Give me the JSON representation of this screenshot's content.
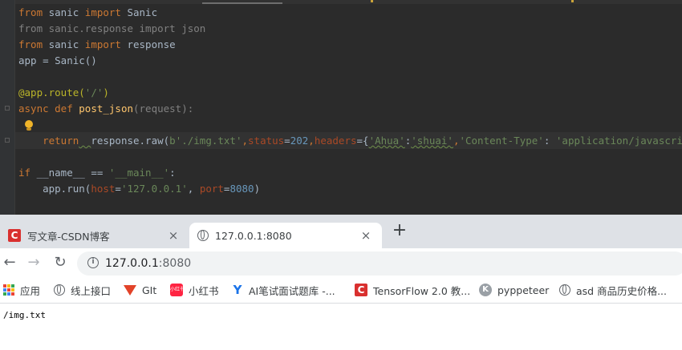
{
  "editor": {
    "lines": [
      {
        "segments": [
          {
            "t": "from",
            "c": "kw"
          },
          {
            "t": " sanic ",
            "c": ""
          },
          {
            "t": "import",
            "c": "kw"
          },
          {
            "t": " Sanic",
            "c": ""
          }
        ]
      },
      {
        "segments": [
          {
            "t": "from sanic.response import json",
            "c": "dim"
          }
        ]
      },
      {
        "segments": [
          {
            "t": "from",
            "c": "kw"
          },
          {
            "t": " sanic ",
            "c": ""
          },
          {
            "t": "import",
            "c": "kw"
          },
          {
            "t": " response",
            "c": ""
          }
        ]
      },
      {
        "segments": [
          {
            "t": "app = Sanic()",
            "c": ""
          }
        ]
      },
      {
        "segments": []
      },
      {
        "segments": [
          {
            "t": "@app.route(",
            "c": "dec"
          },
          {
            "t": "'/'",
            "c": "str"
          },
          {
            "t": ")",
            "c": "dec"
          }
        ]
      },
      {
        "segments": [
          {
            "t": "async def ",
            "c": "kw"
          },
          {
            "t": "post_json",
            "c": "fn"
          },
          {
            "t": "(request):",
            "c": "dim"
          }
        ]
      },
      {
        "segments": []
      },
      {
        "segments": [
          {
            "t": "    ",
            "c": ""
          },
          {
            "t": "return",
            "c": "kw"
          },
          {
            "t": "  ",
            "c": "squig"
          },
          {
            "t": "response.raw(",
            "c": ""
          },
          {
            "t": "b'./img.txt'",
            "c": "str"
          },
          {
            "t": ",",
            "c": "kw"
          },
          {
            "t": "status",
            "c": "prm"
          },
          {
            "t": "=",
            "c": ""
          },
          {
            "t": "202",
            "c": "num"
          },
          {
            "t": ",",
            "c": "kw"
          },
          {
            "t": "headers",
            "c": "prm"
          },
          {
            "t": "={",
            "c": ""
          },
          {
            "t": "'Ahua'",
            "c": "str squig"
          },
          {
            "t": ":",
            "c": ""
          },
          {
            "t": "'shuai'",
            "c": "str squig"
          },
          {
            "t": ",",
            "c": "kw"
          },
          {
            "t": "'Content-Type'",
            "c": "str"
          },
          {
            "t": ": ",
            "c": ""
          },
          {
            "t": "'application/javascript'",
            "c": "str"
          },
          {
            "t": "})",
            "c": ""
          }
        ]
      },
      {
        "segments": []
      },
      {
        "segments": [
          {
            "t": "if ",
            "c": "kw"
          },
          {
            "t": "__name__",
            "c": ""
          },
          {
            "t": " == ",
            "c": ""
          },
          {
            "t": "'__main__'",
            "c": "str"
          },
          {
            "t": ":",
            "c": ""
          }
        ]
      },
      {
        "segments": [
          {
            "t": "    app.run(",
            "c": ""
          },
          {
            "t": "host",
            "c": "prm"
          },
          {
            "t": "=",
            "c": ""
          },
          {
            "t": "'127.0.0.1'",
            "c": "str"
          },
          {
            "t": ", ",
            "c": ""
          },
          {
            "t": "port",
            "c": "prm"
          },
          {
            "t": "=",
            "c": ""
          },
          {
            "t": "8080",
            "c": "num"
          },
          {
            "t": ")",
            "c": ""
          }
        ]
      }
    ]
  },
  "browser": {
    "tabs": [
      {
        "title": "写文章-CSDN博客",
        "close": "×",
        "icon": "csdn-icon",
        "active": false
      },
      {
        "title": "127.0.0.1:8080",
        "close": "×",
        "icon": "globe-icon",
        "active": true
      }
    ],
    "new_tab": "+",
    "nav": {
      "back": "←",
      "forward": "→",
      "reload": "↻"
    },
    "address": {
      "host": "127.0.0.1",
      "port": ":8080"
    },
    "bookmarks": [
      {
        "label": "应用",
        "icon": "apps-grid-icon"
      },
      {
        "label": "线上接口",
        "icon": "globe-icon"
      },
      {
        "label": "GIt",
        "icon": "gitlab-icon"
      },
      {
        "label": "小红书",
        "icon": "xiaohongshu-icon",
        "icon_text": "小红书"
      },
      {
        "label": "AI笔试面试题库 -...",
        "icon": "tf-icon",
        "icon_text": "Y"
      },
      {
        "label": "TensorFlow 2.0 教...",
        "icon": "csdn-icon",
        "icon_text": "C"
      },
      {
        "label": "pyppeteer",
        "icon": "k-icon",
        "icon_text": "K"
      },
      {
        "label": "asd 商品历史价格...",
        "icon": "globe-icon"
      }
    ],
    "csdn_icon_text": "C"
  },
  "page": {
    "body_text": "/img.txt"
  }
}
